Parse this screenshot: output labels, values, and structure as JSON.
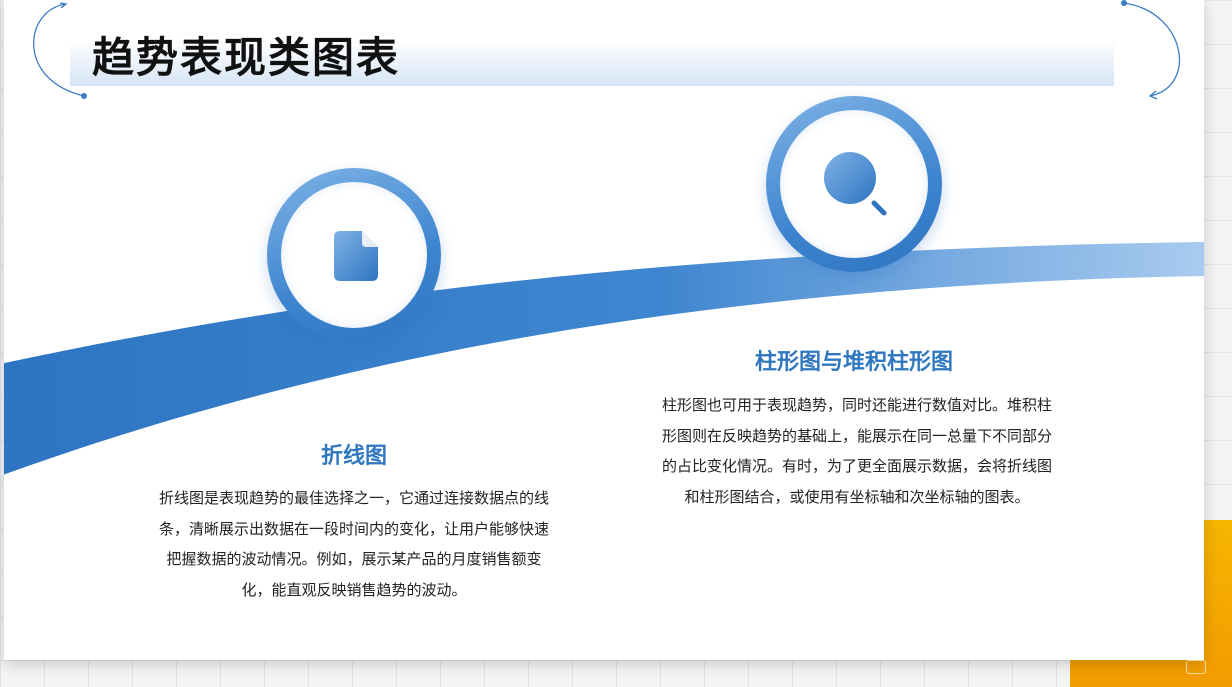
{
  "slide": {
    "title": "趋势表现类图表"
  },
  "cards": [
    {
      "heading": "折线图",
      "icon": "document-icon",
      "lines": [
        "折线图是表现趋势的最佳选择之一，它通过连接数据点的线",
        "条，清晰展示出数据在一段时间内的变化，让用户能够快速",
        "把握数据的波动情况。例如，展示某产品的月度销售额变",
        "化，能直观反映销售趋势的波动。"
      ]
    },
    {
      "heading": "柱形图与堆积柱形图",
      "icon": "search-icon",
      "lines": [
        "柱形图也可用于表现趋势，同时还能进行数值对比。堆积柱",
        "形图则在反映趋势的基础上，能展示在同一总量下不同部分",
        "的占比变化情况。有时，为了更全面展示数据，会将折线图",
        "和柱形图结合，或使用有坐标轴和次坐标轴的图表。"
      ]
    }
  ],
  "colors": {
    "accent_blue": "#2f78c0",
    "accent_orange": "#f7b500",
    "title_band": "#d6e4f6"
  }
}
